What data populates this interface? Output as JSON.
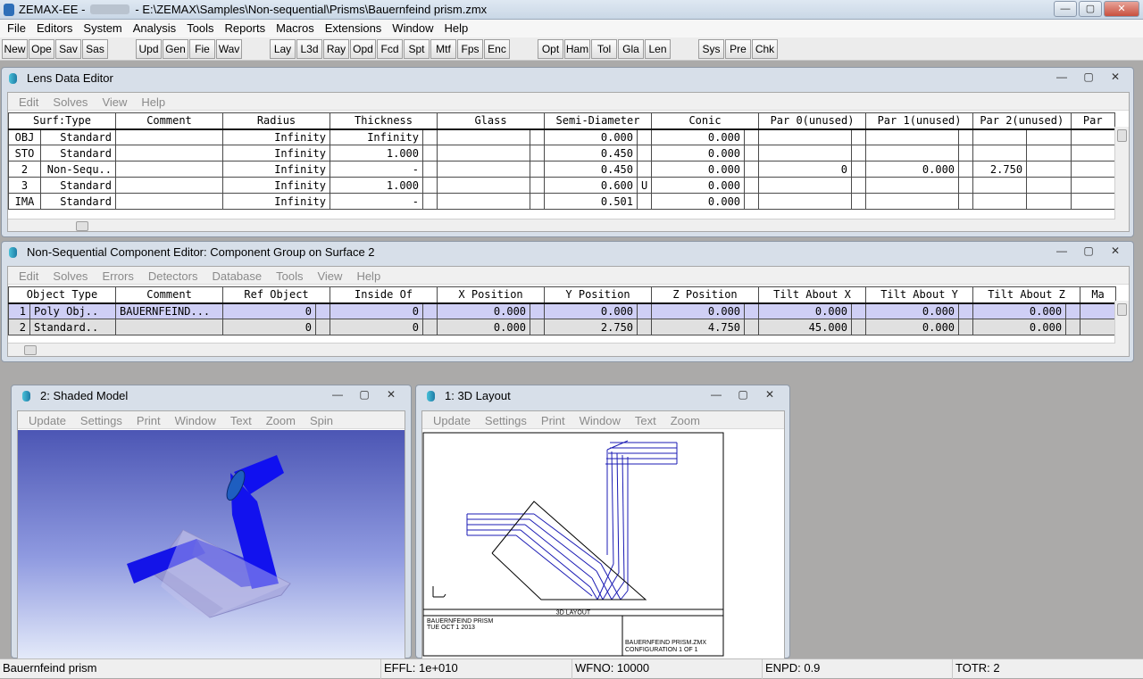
{
  "app": {
    "name": "ZEMAX-EE -",
    "path": "- E:\\ZEMAX\\Samples\\Non-sequential\\Prisms\\Bauernfeind prism.zmx",
    "controls": {
      "minimize": "—",
      "maximize": "▢",
      "close": "✕"
    }
  },
  "menu": [
    "File",
    "Editors",
    "System",
    "Analysis",
    "Tools",
    "Reports",
    "Macros",
    "Extensions",
    "Window",
    "Help"
  ],
  "toolbar": [
    "New",
    "Ope",
    "Sav",
    "Sas",
    "Upd",
    "Gen",
    "Fie",
    "Wav",
    "Lay",
    "L3d",
    "Ray",
    "Opd",
    "Fcd",
    "Spt",
    "Mtf",
    "Fps",
    "Enc",
    "Opt",
    "Ham",
    "Tol",
    "Gla",
    "Len",
    "Sys",
    "Pre",
    "Chk"
  ],
  "lde": {
    "title": "Lens Data Editor",
    "menu": [
      "Edit",
      "Solves",
      "View",
      "Help"
    ],
    "headers": [
      "Surf:Type",
      "Comment",
      "Radius",
      "Thickness",
      "Glass",
      "Semi-Diameter",
      "Conic",
      "Par 0(unused)",
      "Par 1(unused)",
      "Par 2(unused)",
      "Par"
    ],
    "rows": [
      {
        "surf": "OBJ",
        "type": "Standard",
        "comment": "",
        "radius": "Infinity",
        "thickness": "Infinity",
        "glass": "",
        "semi": "0.000",
        "semi_flag": "",
        "conic": "0.000",
        "p0": "",
        "p1": "",
        "p2": ""
      },
      {
        "surf": "STO",
        "type": "Standard",
        "comment": "",
        "radius": "Infinity",
        "thickness": "1.000",
        "glass": "",
        "semi": "0.450",
        "semi_flag": "",
        "conic": "0.000",
        "p0": "",
        "p1": "",
        "p2": ""
      },
      {
        "surf": "2",
        "type": "Non-Sequ..",
        "comment": "",
        "radius": "Infinity",
        "thickness": "-",
        "glass": "",
        "semi": "0.450",
        "semi_flag": "",
        "conic": "0.000",
        "p0": "0",
        "p1": "0.000",
        "p2": "2.750"
      },
      {
        "surf": "3",
        "type": "Standard",
        "comment": "",
        "radius": "Infinity",
        "thickness": "1.000",
        "glass": "",
        "semi": "0.600",
        "semi_flag": "U",
        "conic": "0.000",
        "p0": "",
        "p1": "",
        "p2": ""
      },
      {
        "surf": "IMA",
        "type": "Standard",
        "comment": "",
        "radius": "Infinity",
        "thickness": "-",
        "glass": "",
        "semi": "0.501",
        "semi_flag": "",
        "conic": "0.000",
        "p0": "",
        "p1": "",
        "p2": ""
      }
    ]
  },
  "nsce": {
    "title": "Non-Sequential Component Editor: Component Group on Surface 2",
    "menu": [
      "Edit",
      "Solves",
      "Errors",
      "Detectors",
      "Database",
      "Tools",
      "View",
      "Help"
    ],
    "headers": [
      "Object Type",
      "Comment",
      "Ref Object",
      "Inside Of",
      "X Position",
      "Y Position",
      "Z Position",
      "Tilt About X",
      "Tilt About Y",
      "Tilt About Z",
      "Ma"
    ],
    "rows": [
      {
        "n": "1",
        "type": "Poly Obj..",
        "comment": "BAUERNFEIND...",
        "ref": "0",
        "inside": "0",
        "x": "0.000",
        "y": "0.000",
        "z": "0.000",
        "tx": "0.000",
        "ty": "0.000",
        "tz": "0.000"
      },
      {
        "n": "2",
        "type": "Standard..",
        "comment": "",
        "ref": "0",
        "inside": "0",
        "x": "0.000",
        "y": "2.750",
        "z": "4.750",
        "tx": "45.000",
        "ty": "0.000",
        "tz": "0.000"
      }
    ]
  },
  "shaded": {
    "title": "2: Shaded Model",
    "menu": [
      "Update",
      "Settings",
      "Print",
      "Window",
      "Text",
      "Zoom",
      "Spin"
    ]
  },
  "layout3d": {
    "title": "1: 3D Layout",
    "menu": [
      "Update",
      "Settings",
      "Print",
      "Window",
      "Text",
      "Zoom"
    ],
    "caption": "3D LAYOUT",
    "lens_name": "BAUERNFEIND PRISM",
    "date": "TUE OCT 1 2013",
    "file": "BAUERNFEIND PRISM.ZMX",
    "config": "CONFIGURATION 1 OF 1"
  },
  "status": {
    "name": "Bauernfeind prism",
    "effl": "EFFL: 1e+010",
    "wfno": "WFNO: 10000",
    "enpd": "ENPD: 0.9",
    "totr": "TOTR: 2"
  },
  "colors": {
    "ray": "#1b1bb4",
    "prism": "#9a9ad8",
    "beam": "#1010e6"
  }
}
